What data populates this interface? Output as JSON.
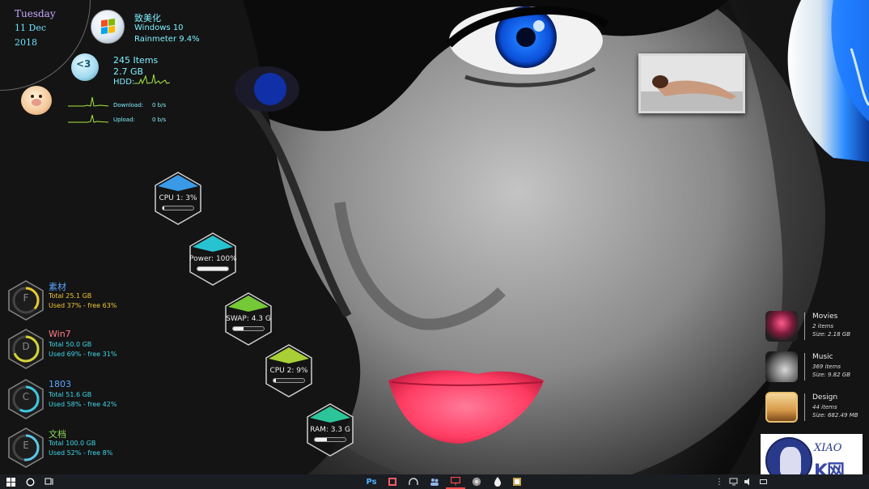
{
  "clock": {
    "day": "Tuesday",
    "date": "11 Dec",
    "year": "2018"
  },
  "system": {
    "name": "致美化",
    "os": "Windows 10",
    "app": "Rainmeter 9.4%"
  },
  "recycle_bin": {
    "items": "245 Items",
    "size": "2.7 GB",
    "hdd_label": "HDD:"
  },
  "network": {
    "download_label": "Download:",
    "download_value": "0 b/s",
    "upload_label": "Upload:",
    "upload_value": "0 b/s"
  },
  "meters": [
    {
      "label": "CPU 1: 3%",
      "fraction": 0.03,
      "gem": "#3fa8ff"
    },
    {
      "label": "Power: 100%",
      "fraction": 1.0,
      "gem": "#29d6e6"
    },
    {
      "label": "SWAP: 4.3 G",
      "fraction": 0.35,
      "gem": "#7fdc3a"
    },
    {
      "label": "CPU 2: 9%",
      "fraction": 0.09,
      "gem": "#b8e33a"
    },
    {
      "label": "RAM: 3.3 G",
      "fraction": 0.4,
      "gem": "#2fd8a8"
    }
  ],
  "drives": [
    {
      "letter": "F",
      "name": "素材",
      "total": "Total 25.1 GB",
      "used": "Used 37% - free 63%",
      "name_color": "#5aa6ff",
      "stat_color": "#f0c838",
      "ring_color": "#e8c832",
      "used_fraction": 0.37
    },
    {
      "letter": "D",
      "name": "Win7",
      "total": "Total 50.0 GB",
      "used": "Used 69% - free 31%",
      "name_color": "#ff7a8a",
      "stat_color": "#3fd7e8",
      "ring_color": "#d4d43a",
      "used_fraction": 0.69
    },
    {
      "letter": "C",
      "name": "1803",
      "total": "Total 51.6 GB",
      "used": "Used 58% - free 42%",
      "name_color": "#5aa6ff",
      "stat_color": "#3fd7e8",
      "ring_color": "#3fc8e0",
      "used_fraction": 0.58
    },
    {
      "letter": "E",
      "name": "文档",
      "total": "Total 100.0 GB",
      "used": "Used 52% - free 8%",
      "name_color": "#8ad85a",
      "stat_color": "#3fd7e8",
      "ring_color": "#5ac8e8",
      "used_fraction": 0.52
    }
  ],
  "folders": [
    {
      "name": "Movies",
      "items": "2 items",
      "size": "Size: 2.18 GB",
      "icon": "movies-icon"
    },
    {
      "name": "Music",
      "items": "369 items",
      "size": "Size: 9.82 GB",
      "icon": "music-icon"
    },
    {
      "name": "Design",
      "items": "44 items",
      "size": "Size: 682.49 MB",
      "icon": "design-icon"
    }
  ],
  "watermark": {
    "line1": "XIAO",
    "line2": "K网"
  },
  "taskbar": {
    "ps_label": "Ps",
    "icons": [
      "start-icon",
      "search-icon",
      "task-view-icon"
    ]
  }
}
